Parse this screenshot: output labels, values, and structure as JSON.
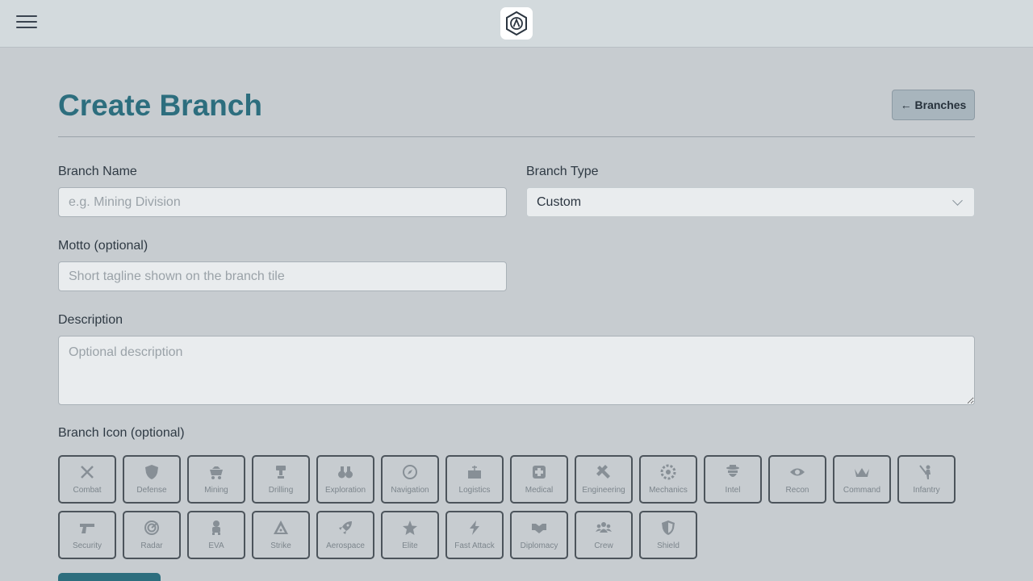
{
  "header": {
    "menu_icon": "hamburger-icon",
    "logo_icon": "hexagon-logo-icon"
  },
  "page": {
    "title": "Create Branch",
    "back_label": "← Branches"
  },
  "form": {
    "branch_name": {
      "label": "Branch Name",
      "value": "",
      "placeholder": "e.g. Mining Division"
    },
    "branch_type": {
      "label": "Branch Type",
      "value": "Custom"
    },
    "motto": {
      "label": "Motto (optional)",
      "value": "",
      "placeholder": "Short tagline shown on the branch tile"
    },
    "description": {
      "label": "Description",
      "value": "",
      "placeholder": "Optional description"
    },
    "icon_label": "Branch Icon (optional)"
  },
  "icons": [
    {
      "label": "Combat",
      "icon": "crossed-swords-icon"
    },
    {
      "label": "Defense",
      "icon": "shield-icon"
    },
    {
      "label": "Mining",
      "icon": "mine-cart-icon"
    },
    {
      "label": "Drilling",
      "icon": "drill-icon"
    },
    {
      "label": "Exploration",
      "icon": "binoculars-icon"
    },
    {
      "label": "Navigation",
      "icon": "compass-icon"
    },
    {
      "label": "Logistics",
      "icon": "cargo-crate-icon"
    },
    {
      "label": "Medical",
      "icon": "medical-cross-icon"
    },
    {
      "label": "Engineering",
      "icon": "wrench-icon"
    },
    {
      "label": "Mechanics",
      "icon": "gear-icon"
    },
    {
      "label": "Intel",
      "icon": "spy-icon"
    },
    {
      "label": "Recon",
      "icon": "eye-icon"
    },
    {
      "label": "Command",
      "icon": "crown-icon"
    },
    {
      "label": "Infantry",
      "icon": "soldier-icon"
    },
    {
      "label": "Security",
      "icon": "pistol-icon"
    },
    {
      "label": "Radar",
      "icon": "radar-icon"
    },
    {
      "label": "EVA",
      "icon": "astronaut-icon"
    },
    {
      "label": "Strike",
      "icon": "target-triangle-icon"
    },
    {
      "label": "Aerospace",
      "icon": "rocket-icon"
    },
    {
      "label": "Elite",
      "icon": "star-icon"
    },
    {
      "label": "Fast Attack",
      "icon": "lightning-icon"
    },
    {
      "label": "Diplomacy",
      "icon": "handshake-icon"
    },
    {
      "label": "Crew",
      "icon": "group-icon"
    },
    {
      "label": "Shield",
      "icon": "half-shield-icon"
    }
  ],
  "colors": {
    "accent": "#2d6e7e",
    "background": "#c7ccd0",
    "topbar": "#d3dadd"
  }
}
